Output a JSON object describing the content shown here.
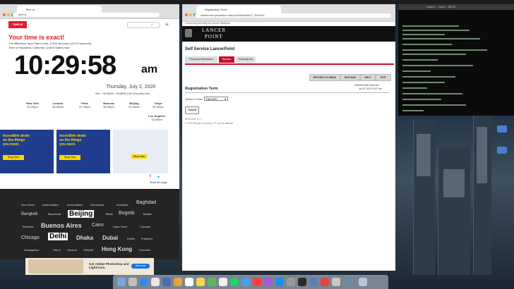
{
  "timeis": {
    "tab_title": "Time.is",
    "url": "time.is",
    "logo": "TIME.IS",
    "headline": "Your time is exact!",
    "sub1": "The difference from Time.is was -0.000 seconds (±0.074 seconds).",
    "sub2": "Time in Pasadena, California, United States now:",
    "time": "10:29:58",
    "ampm": "am",
    "date": "Thursday, July 2, 2020",
    "sun": "Sun: ↑ 05:46AM ↓ 08:08PM (14h 22m) More info",
    "cities": [
      {
        "name": "New York",
        "time": "01:29pm"
      },
      {
        "name": "London",
        "time": "06:29am"
      },
      {
        "name": "Paris",
        "time": "07:29pm"
      },
      {
        "name": "Moscow",
        "time": "08:29pm"
      },
      {
        "name": "Beijing",
        "time": "01:29am"
      },
      {
        "name": "Tokyo",
        "time": "02:29am"
      },
      {
        "name": "Los Angeles",
        "time": "10:29am"
      }
    ],
    "ad1": "Incredible deals on the things you need.",
    "ad2": "Incredible deals on the things you need.",
    "ad_shop": "Shop Now",
    "share": "Share this page",
    "city_cloud": [
      "Abu Dhabi",
      "Addis Ababa",
      "Ahmedabad",
      "Alexandria",
      "Auckland",
      "Baghdad",
      "Bangkok",
      "Barcelona",
      "Beijing",
      "Berlin",
      "Bogotá",
      "Boston",
      "Brussels",
      "Buenos Aires",
      "Cairo",
      "Cape Town",
      "Caracas",
      "Chicago",
      "Delhi",
      "Dhaka",
      "Dubai",
      "Dublin",
      "Frankfurt",
      "Guangzhou",
      "Hanoi",
      "Havana",
      "Helsinki",
      "Hong Kong",
      "Honolulu"
    ],
    "banner": "Get Adobe Photoshop and Lightroom.",
    "banner_btn": "Start now"
  },
  "lancer": {
    "tab_title": "Registration Term",
    "url": "selfservice.pasadena.edu/prod/bwskflib.P_SelTerm",
    "secure": "Connecting securely via secure database",
    "logo_top": "LANCER",
    "logo_bottom": "POINT",
    "title": "Self Service LancerPoint",
    "tabs": [
      "Personal Information",
      "Student",
      "Financial Aid"
    ],
    "buttons": [
      "RETURN TO MENU",
      "SITE MAP",
      "HELP",
      "EXIT"
    ],
    "heading": "Registration Term",
    "user_line1": "0000000 Wan Rout Kim",
    "user_line2": "Jul 02, 2020 10:27 am",
    "select_label": "Select a Term:",
    "select_value": "Fall 2020",
    "submit": "Submit",
    "release": "RELEASE: 8.7.1",
    "copyright": "© 2020 Ellucian Company L.P. and its affiliates."
  },
  "terminal": {
    "title": "student — -bash — 80×24"
  },
  "colors": {
    "timeis_red": "#e01f2b",
    "lancer_red": "#c8102e",
    "ad_blue": "#1f3d8c",
    "ad_yellow": "#ffd700"
  }
}
